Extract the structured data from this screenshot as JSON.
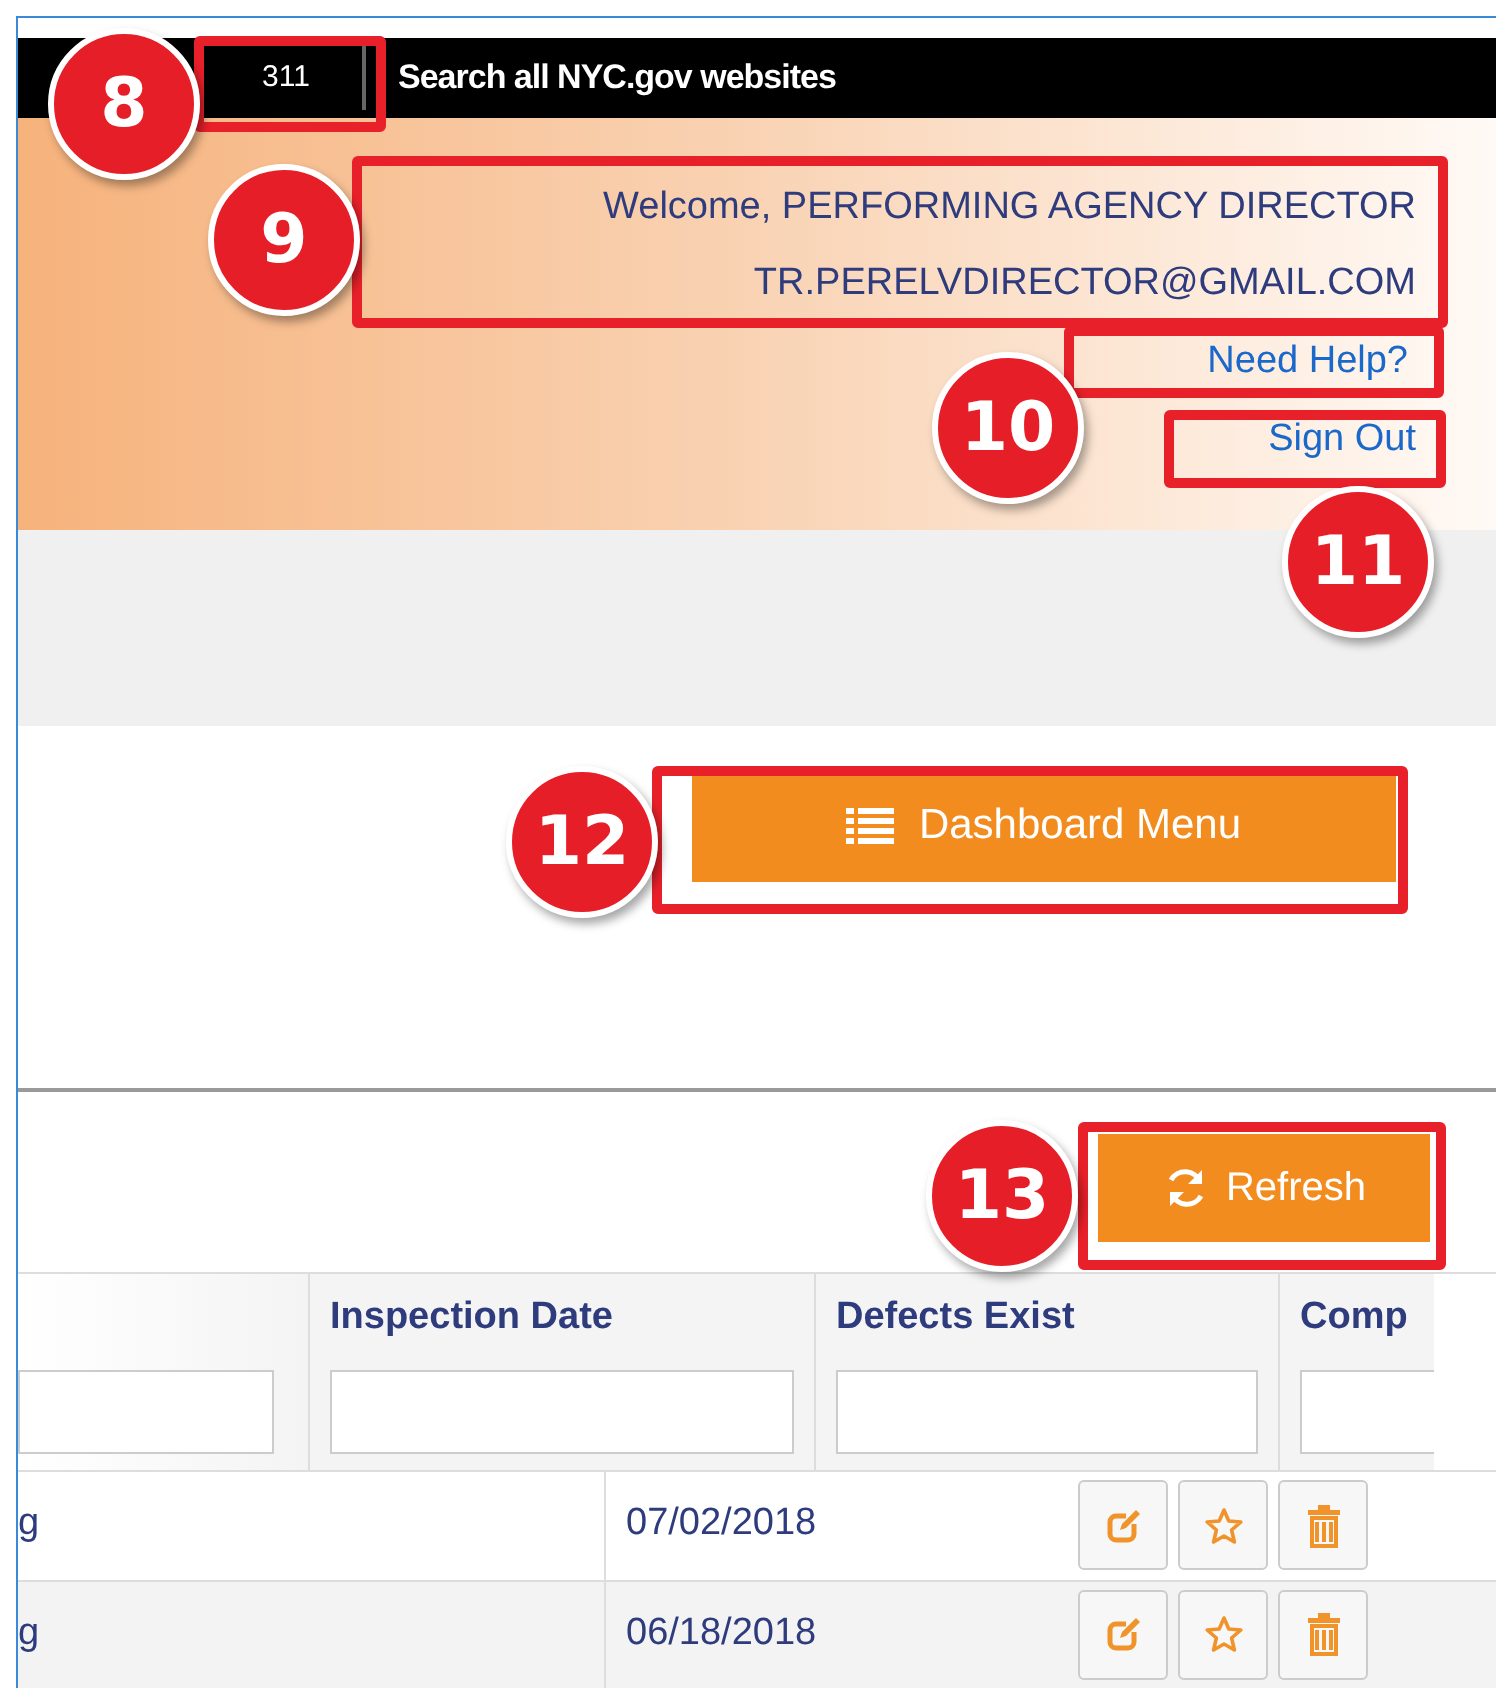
{
  "top_bar": {
    "badge": "311",
    "search_link": "Search all NYC.gov websites"
  },
  "header": {
    "welcome": "Welcome, PERFORMING AGENCY DIRECTOR",
    "email": "TR.PERELVDIRECTOR@GMAIL.COM",
    "help_link": "Need Help?",
    "sign_out_link": "Sign Out"
  },
  "dashboard_button": "Dashboard Menu",
  "refresh_button": "Refresh",
  "table": {
    "columns": [
      "Inspection Date",
      "Defects Exist",
      "Comp"
    ],
    "rows": [
      {
        "column_1": "g",
        "inspection_date": "07/02/2018"
      },
      {
        "column_1": "g",
        "inspection_date": "06/18/2018"
      }
    ]
  },
  "callouts": [
    {
      "number": "8"
    },
    {
      "number": "9"
    },
    {
      "number": "10"
    },
    {
      "number": "11"
    },
    {
      "number": "12"
    },
    {
      "number": "13"
    }
  ]
}
